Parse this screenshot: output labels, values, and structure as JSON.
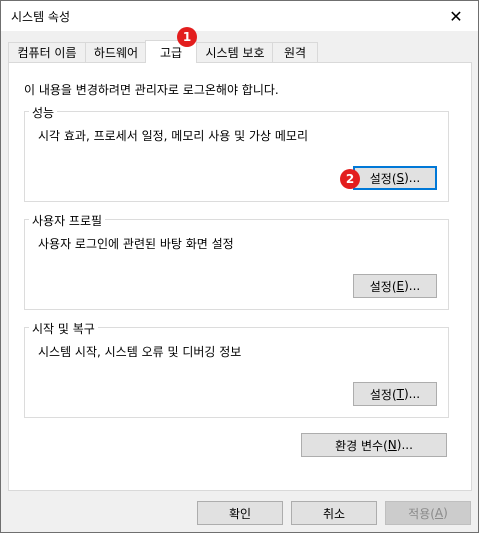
{
  "window": {
    "title": "시스템 속성",
    "close_label": "✕"
  },
  "tabs": [
    {
      "label": "컴퓨터 이름"
    },
    {
      "label": "하드웨어"
    },
    {
      "label": "고급",
      "active": true
    },
    {
      "label": "시스템 보호"
    },
    {
      "label": "원격"
    }
  ],
  "notice": "이 내용을 변경하려면 관리자로 로그온해야 합니다.",
  "performance": {
    "label": "성능",
    "description": "시각 효과, 프로세서 일정, 메모리 사용 및 가상 메모리",
    "button_pre": "설정(",
    "button_key": "S",
    "button_post": ")..."
  },
  "user_profiles": {
    "label": "사용자 프로필",
    "description": "사용자 로그인에 관련된 바탕 화면 설정",
    "button_pre": "설정(",
    "button_key": "E",
    "button_post": ")..."
  },
  "startup_recovery": {
    "label": "시작 및 복구",
    "description": "시스템 시작, 시스템 오류 및 디버깅 정보",
    "button_pre": "설정(",
    "button_key": "T",
    "button_post": ")..."
  },
  "env_button": {
    "pre": "환경 변수(",
    "key": "N",
    "post": ")..."
  },
  "footer": {
    "ok": "확인",
    "cancel": "취소",
    "apply_pre": "적용(",
    "apply_key": "A",
    "apply_post": ")"
  },
  "markers": {
    "one": "1",
    "two": "2"
  },
  "colors": {
    "marker": "#e31e1e",
    "focus": "#0078d7"
  }
}
